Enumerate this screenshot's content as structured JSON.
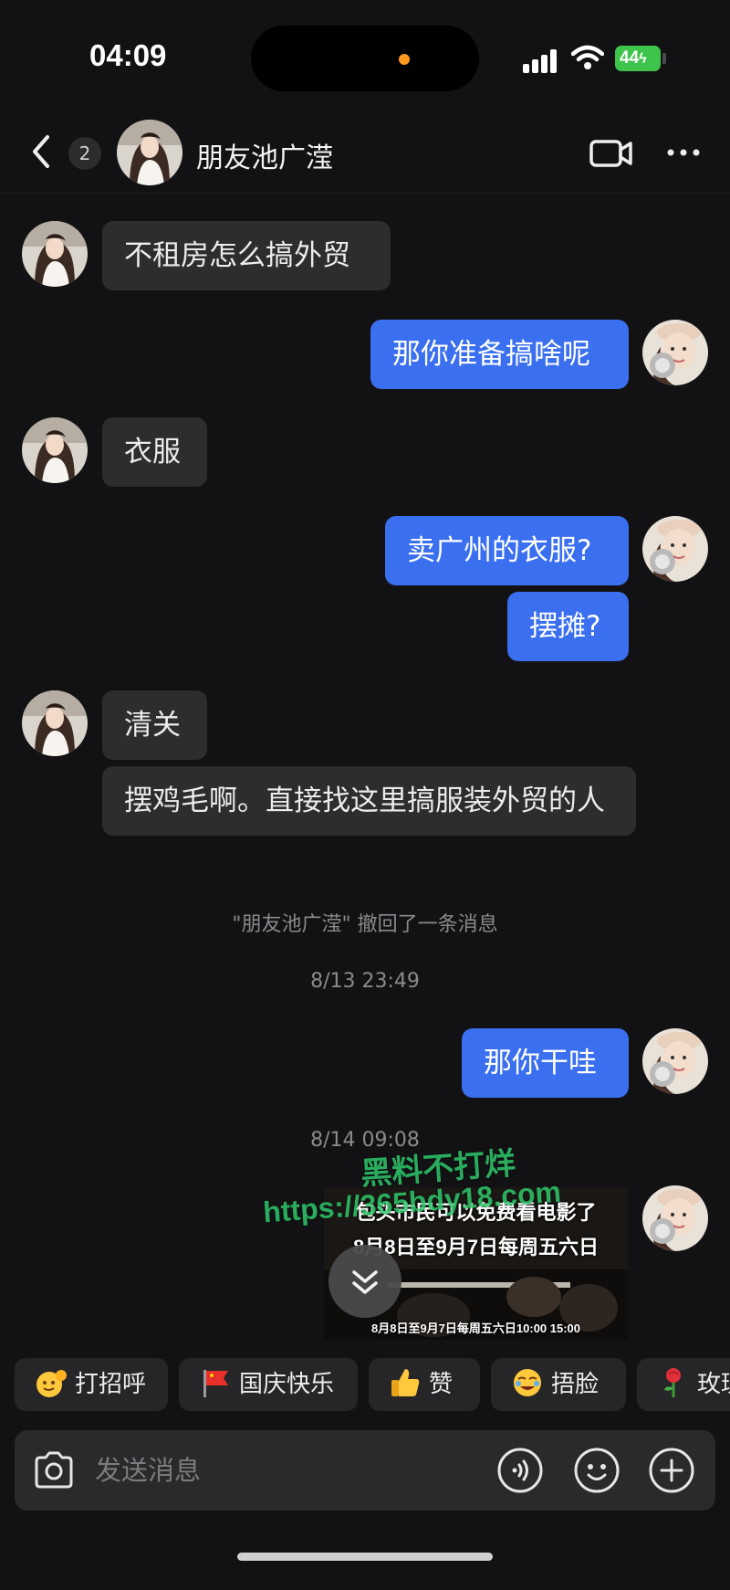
{
  "status_bar": {
    "time": "04:09",
    "battery": "44",
    "icons": [
      "cellular-signal-icon",
      "wifi-icon",
      "battery-charging-icon"
    ]
  },
  "header": {
    "unread_count": "2",
    "title": "朋友池广滢",
    "icons": [
      "back-icon",
      "video-call-icon",
      "more-icon"
    ]
  },
  "messages": [
    {
      "side": "in",
      "text": "不租房怎么搞外贸"
    },
    {
      "side": "out",
      "text": "那你准备搞啥呢"
    },
    {
      "side": "in",
      "text": "衣服"
    },
    {
      "side": "out",
      "text": "卖广州的衣服?"
    },
    {
      "side": "out",
      "text": "摆摊?"
    },
    {
      "side": "in",
      "text": "清关"
    },
    {
      "side": "in",
      "text": "摆鸡毛啊。直接找这里搞服装外贸的人"
    },
    {
      "side": "out",
      "text": "那你干哇"
    }
  ],
  "system": {
    "recall_notice": "\"朋友池广滢\" 撤回了一条消息",
    "timestamp_1": "8/13 23:49",
    "timestamp_2": "8/14 09:08"
  },
  "video_card": {
    "line1": "包头市民可以免费看电影了",
    "line2": "8月8日至9月7日每周五六日",
    "caption": "8月8日至9月7日每周五六日10:00 15:00"
  },
  "watermark": {
    "line1": "黑料不打烊",
    "line2": "https://365bdy18.com"
  },
  "quick_replies": [
    {
      "label": "打招呼",
      "icon": "wave-face-icon"
    },
    {
      "label": "国庆快乐",
      "icon": "red-flag-icon"
    },
    {
      "label": "赞",
      "icon": "thumbs-up-icon"
    },
    {
      "label": "捂脸",
      "icon": "facepalm-icon"
    },
    {
      "label": "玫瑰",
      "icon": "rose-icon"
    }
  ],
  "composer": {
    "placeholder": "发送消息",
    "icons": [
      "camera-icon",
      "voice-icon",
      "emoji-icon",
      "plus-icon"
    ]
  },
  "colors": {
    "background": "#121214",
    "incoming_bubble": "#2d2d30",
    "outgoing_bubble": "#3a6ff0",
    "battery": "#3ec44b",
    "watermark": "#2ec86a"
  }
}
